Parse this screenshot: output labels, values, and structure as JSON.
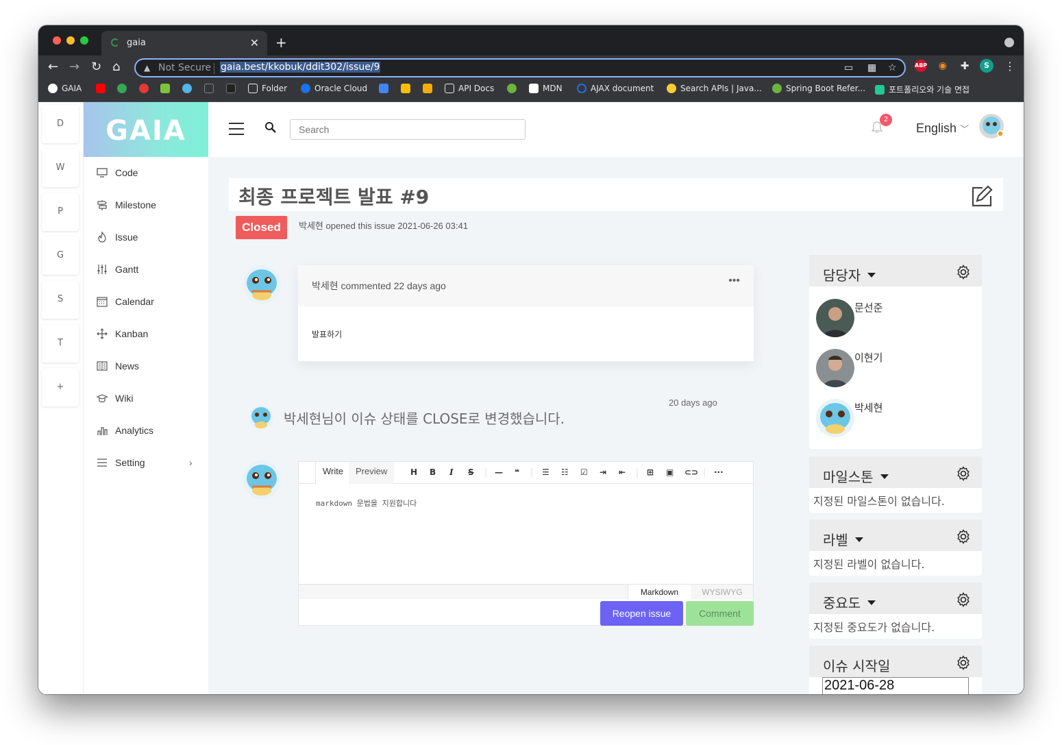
{
  "browser": {
    "tab_title": "gaia",
    "security_label": "Not Secure",
    "url": "gaia.best/kkobuk/ddit302/issue/9",
    "profile_initial": "S",
    "bookmarks": [
      {
        "label": "GAIA"
      },
      {
        "label": "Folder"
      },
      {
        "label": "Oracle Cloud"
      },
      {
        "label": "API Docs"
      },
      {
        "label": "MDN"
      },
      {
        "label": "AJAX document"
      },
      {
        "label": "Search APIs | Java..."
      },
      {
        "label": "Spring Boot Refer..."
      },
      {
        "label": "포트폴리오와 기술 면접"
      }
    ]
  },
  "workspaces": [
    "D",
    "W",
    "P",
    "G",
    "S",
    "T",
    "+"
  ],
  "sidebar": {
    "logo": "GAIA",
    "items": [
      {
        "label": "Code",
        "icon": "monitor-icon"
      },
      {
        "label": "Milestone",
        "icon": "signpost-icon"
      },
      {
        "label": "Issue",
        "icon": "fire-icon"
      },
      {
        "label": "Gantt",
        "icon": "sliders-icon"
      },
      {
        "label": "Calendar",
        "icon": "calendar-icon"
      },
      {
        "label": "Kanban",
        "icon": "move-icon"
      },
      {
        "label": "News",
        "icon": "newspaper-icon"
      },
      {
        "label": "Wiki",
        "icon": "graduation-cap-icon"
      },
      {
        "label": "Analytics",
        "icon": "bar-chart-icon"
      },
      {
        "label": "Setting",
        "icon": "menu-icon"
      }
    ]
  },
  "topbar": {
    "search_placeholder": "Search",
    "notification_count": "2",
    "language": "English"
  },
  "issue": {
    "title": "최종 프로젝트 발표 #9",
    "status": "Closed",
    "opened_text": "박세현 opened this issue 2021-06-26 03:41",
    "comment": {
      "header": "박세현 commented 22 days ago",
      "body": "발표하기"
    },
    "event": {
      "time": "20 days ago",
      "text": "박세현님이 이슈 상태를 CLOSE로 변경했습니다."
    }
  },
  "editor": {
    "tabs": [
      "Write",
      "Preview"
    ],
    "placeholder": "markdown 문법을 지원합니다",
    "modes": [
      "Markdown",
      "WYSIWYG"
    ],
    "reopen_label": "Reopen issue",
    "comment_label": "Comment"
  },
  "right_panels": {
    "assignees": {
      "title": "담당자",
      "people": [
        "문선준",
        "이현기",
        "박세현"
      ]
    },
    "milestone": {
      "title": "마일스톤",
      "empty": "지정된 마일스톤이 없습니다."
    },
    "label": {
      "title": "라벨",
      "empty": "지정된 라벨이 없습니다."
    },
    "priority": {
      "title": "중요도",
      "empty": "지정된 중요도가 없습니다."
    },
    "start_date": {
      "title": "이슈 시작일",
      "value": "2021-06-28"
    }
  },
  "colors": {
    "closed": "#f05b5b",
    "reopen": "#6c63f5",
    "comment": "#9ee29a",
    "logo_gradient_start": "#a8c4ec",
    "logo_gradient_end": "#7ff0d8"
  }
}
